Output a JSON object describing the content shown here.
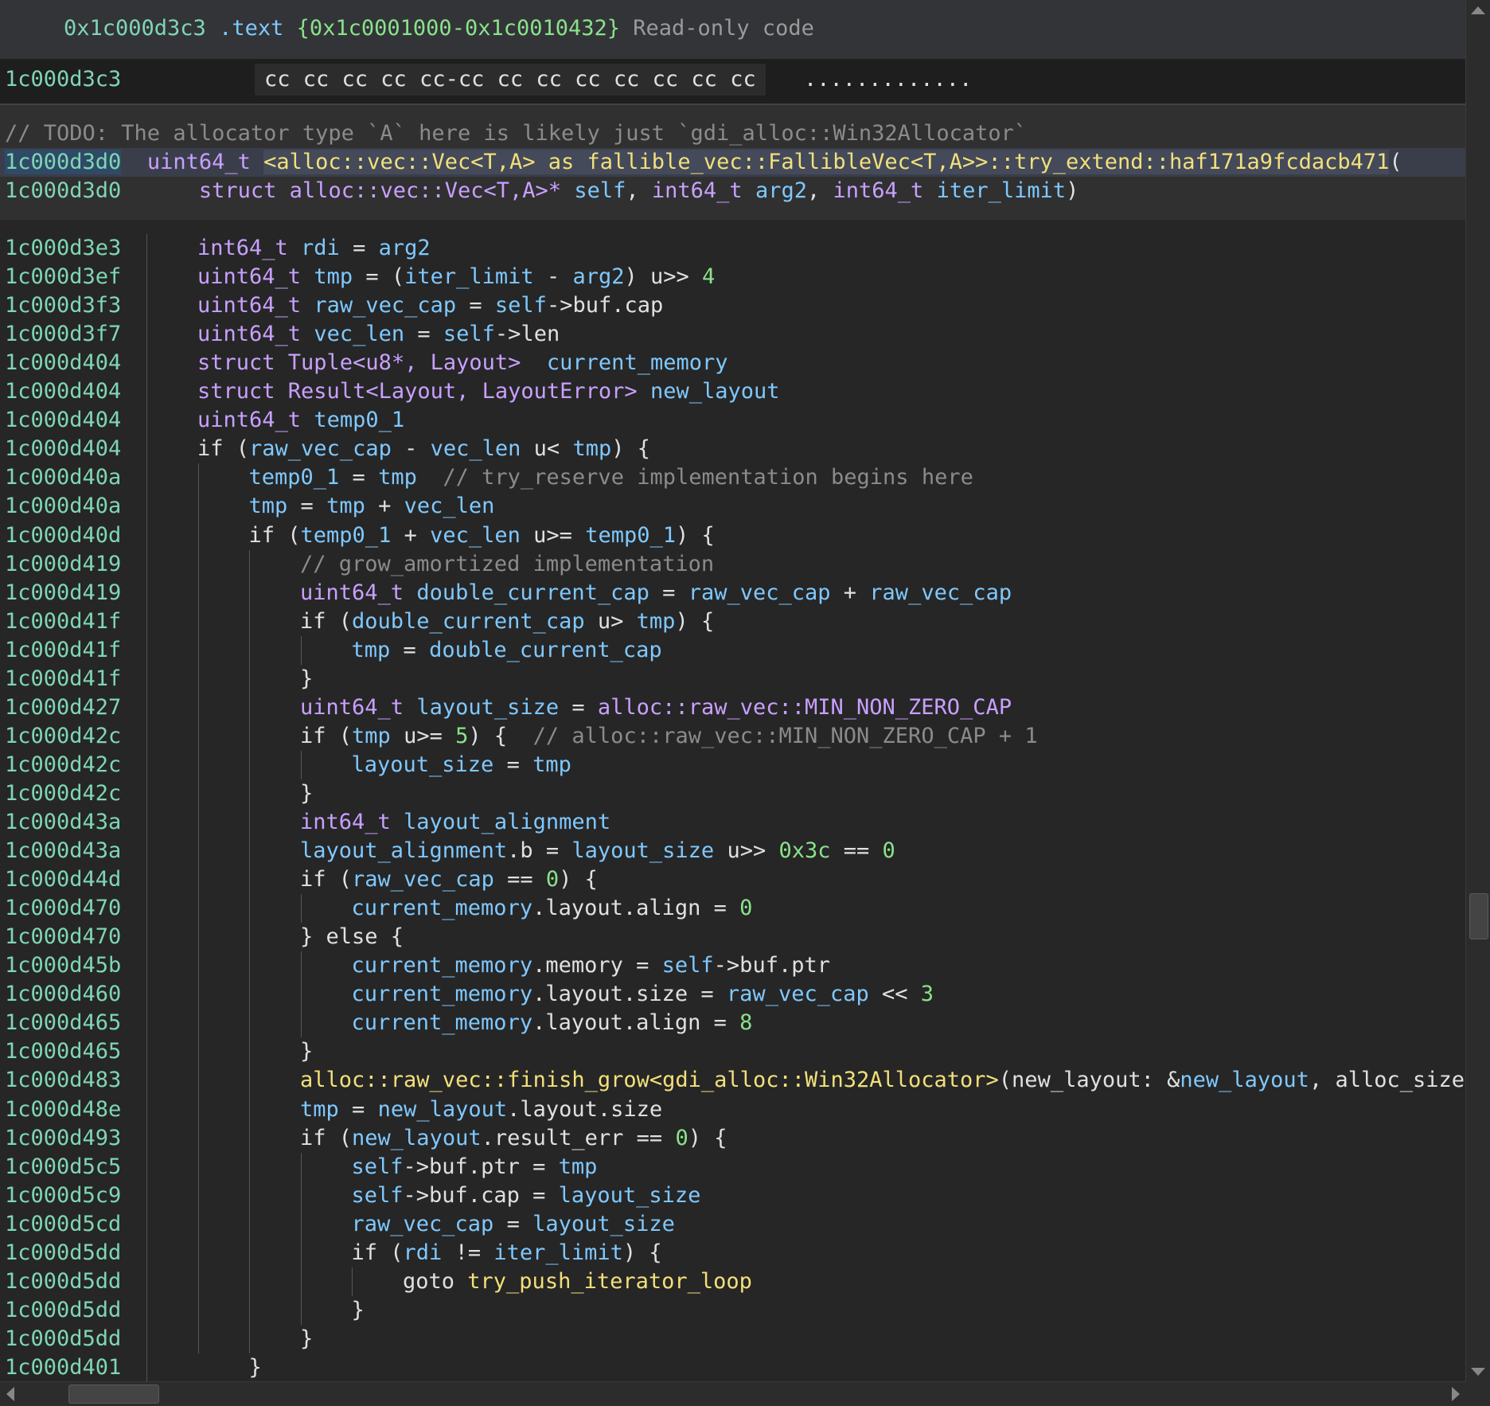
{
  "section": {
    "address": "0x1c000d3c3",
    "name": ".text",
    "range": "{0x1c0001000-0x1c0010432}",
    "kind": "Read-only code"
  },
  "hex": {
    "address": "1c000d3c3",
    "bytes": "cc cc cc cc cc-cc cc cc cc cc cc cc cc",
    "ascii": "............."
  },
  "function": {
    "todo_comment": "// TODO: The allocator type `A` here is likely just `gdi_alloc::Win32Allocator`",
    "address": "1c000d3d0",
    "return_type": "uint64_t",
    "name": "<alloc::vec::Vec<T,A> as fallible_vec::FallibleVec<T,A>>::try_extend::haf171a9fcdacb471",
    "open_paren": "(",
    "param_prefix": "struct",
    "param1_type": "alloc::vec::Vec<T,A>*",
    "param1_name": "self",
    "param2_type": "int64_t",
    "param2_name": "arg2",
    "param3_type": "int64_t",
    "param3_name": "iter_limit",
    "close_paren": ")",
    "comma": ","
  },
  "lines": [
    {
      "addr": "1c000d3e3",
      "indent": 1,
      "tokens": [
        [
          "type",
          "int64_t "
        ],
        [
          "var",
          "rdi"
        ],
        [
          "plain",
          " = "
        ],
        [
          "var",
          "arg2"
        ]
      ]
    },
    {
      "addr": "1c000d3ef",
      "indent": 1,
      "tokens": [
        [
          "type",
          "uint64_t "
        ],
        [
          "var",
          "tmp"
        ],
        [
          "plain",
          " = ("
        ],
        [
          "var",
          "iter_limit"
        ],
        [
          "plain",
          " - "
        ],
        [
          "var",
          "arg2"
        ],
        [
          "plain",
          ") u>> "
        ],
        [
          "num",
          "4"
        ]
      ]
    },
    {
      "addr": "1c000d3f3",
      "indent": 1,
      "tokens": [
        [
          "type",
          "uint64_t "
        ],
        [
          "var",
          "raw_vec_cap"
        ],
        [
          "plain",
          " = "
        ],
        [
          "var",
          "self"
        ],
        [
          "plain",
          "->buf.cap"
        ]
      ]
    },
    {
      "addr": "1c000d3f7",
      "indent": 1,
      "tokens": [
        [
          "type",
          "uint64_t "
        ],
        [
          "var",
          "vec_len"
        ],
        [
          "plain",
          " = "
        ],
        [
          "var",
          "self"
        ],
        [
          "plain",
          "->len"
        ]
      ]
    },
    {
      "addr": "1c000d404",
      "indent": 1,
      "tokens": [
        [
          "type",
          "struct Tuple<u8*, Layout>  "
        ],
        [
          "var",
          "current_memory"
        ]
      ]
    },
    {
      "addr": "1c000d404",
      "indent": 1,
      "tokens": [
        [
          "type",
          "struct Result<Layout, LayoutError> "
        ],
        [
          "var",
          "new_layout"
        ]
      ]
    },
    {
      "addr": "1c000d404",
      "indent": 1,
      "tokens": [
        [
          "type",
          "uint64_t "
        ],
        [
          "var",
          "temp0_1"
        ]
      ]
    },
    {
      "addr": "1c000d404",
      "indent": 1,
      "tokens": [
        [
          "plain",
          "if ("
        ],
        [
          "var",
          "raw_vec_cap"
        ],
        [
          "plain",
          " - "
        ],
        [
          "var",
          "vec_len"
        ],
        [
          "plain",
          " u< "
        ],
        [
          "var",
          "tmp"
        ],
        [
          "plain",
          ") {"
        ]
      ]
    },
    {
      "addr": "1c000d40a",
      "indent": 2,
      "tokens": [
        [
          "var",
          "temp0_1"
        ],
        [
          "plain",
          " = "
        ],
        [
          "var",
          "tmp"
        ],
        [
          "comment",
          "  // try_reserve implementation begins here"
        ]
      ]
    },
    {
      "addr": "1c000d40a",
      "indent": 2,
      "tokens": [
        [
          "var",
          "tmp"
        ],
        [
          "plain",
          " = "
        ],
        [
          "var",
          "tmp"
        ],
        [
          "plain",
          " + "
        ],
        [
          "var",
          "vec_len"
        ]
      ]
    },
    {
      "addr": "1c000d40d",
      "indent": 2,
      "tokens": [
        [
          "plain",
          "if ("
        ],
        [
          "var",
          "temp0_1"
        ],
        [
          "plain",
          " + "
        ],
        [
          "var",
          "vec_len"
        ],
        [
          "plain",
          " u>= "
        ],
        [
          "var",
          "temp0_1"
        ],
        [
          "plain",
          ") {"
        ]
      ]
    },
    {
      "addr": "1c000d419",
      "indent": 3,
      "tokens": [
        [
          "comment",
          "// grow_amortized implementation"
        ]
      ]
    },
    {
      "addr": "1c000d419",
      "indent": 3,
      "tokens": [
        [
          "type",
          "uint64_t "
        ],
        [
          "var",
          "double_current_cap"
        ],
        [
          "plain",
          " = "
        ],
        [
          "var",
          "raw_vec_cap"
        ],
        [
          "plain",
          " + "
        ],
        [
          "var",
          "raw_vec_cap"
        ]
      ]
    },
    {
      "addr": "1c000d41f",
      "indent": 3,
      "tokens": [
        [
          "plain",
          "if ("
        ],
        [
          "var",
          "double_current_cap"
        ],
        [
          "plain",
          " u> "
        ],
        [
          "var",
          "tmp"
        ],
        [
          "plain",
          ") {"
        ]
      ]
    },
    {
      "addr": "1c000d41f",
      "indent": 4,
      "tokens": [
        [
          "var",
          "tmp"
        ],
        [
          "plain",
          " = "
        ],
        [
          "var",
          "double_current_cap"
        ]
      ]
    },
    {
      "addr": "1c000d41f",
      "indent": 3,
      "tokens": [
        [
          "plain",
          "}"
        ]
      ]
    },
    {
      "addr": "1c000d427",
      "indent": 3,
      "tokens": [
        [
          "type",
          "uint64_t "
        ],
        [
          "var",
          "layout_size"
        ],
        [
          "plain",
          " = "
        ],
        [
          "type",
          "alloc::raw_vec::MIN_NON_ZERO_CAP"
        ]
      ]
    },
    {
      "addr": "1c000d42c",
      "indent": 3,
      "tokens": [
        [
          "plain",
          "if ("
        ],
        [
          "var",
          "tmp"
        ],
        [
          "plain",
          " u>= "
        ],
        [
          "num",
          "5"
        ],
        [
          "plain",
          ") {"
        ],
        [
          "comment",
          "  // alloc::raw_vec::MIN_NON_ZERO_CAP + 1"
        ]
      ]
    },
    {
      "addr": "1c000d42c",
      "indent": 4,
      "tokens": [
        [
          "var",
          "layout_size"
        ],
        [
          "plain",
          " = "
        ],
        [
          "var",
          "tmp"
        ]
      ]
    },
    {
      "addr": "1c000d42c",
      "indent": 3,
      "tokens": [
        [
          "plain",
          "}"
        ]
      ]
    },
    {
      "addr": "1c000d43a",
      "indent": 3,
      "tokens": [
        [
          "type",
          "int64_t "
        ],
        [
          "var",
          "layout_alignment"
        ]
      ]
    },
    {
      "addr": "1c000d43a",
      "indent": 3,
      "tokens": [
        [
          "var",
          "layout_alignment"
        ],
        [
          "plain",
          ".b = "
        ],
        [
          "var",
          "layout_size"
        ],
        [
          "plain",
          " u>> "
        ],
        [
          "num",
          "0x3c"
        ],
        [
          "plain",
          " == "
        ],
        [
          "num",
          "0"
        ]
      ]
    },
    {
      "addr": "1c000d44d",
      "indent": 3,
      "tokens": [
        [
          "plain",
          "if ("
        ],
        [
          "var",
          "raw_vec_cap"
        ],
        [
          "plain",
          " == "
        ],
        [
          "num",
          "0"
        ],
        [
          "plain",
          ") {"
        ]
      ]
    },
    {
      "addr": "1c000d470",
      "indent": 4,
      "tokens": [
        [
          "var",
          "current_memory"
        ],
        [
          "plain",
          ".layout.align = "
        ],
        [
          "num",
          "0"
        ]
      ]
    },
    {
      "addr": "1c000d470",
      "indent": 3,
      "tokens": [
        [
          "plain",
          "} else {"
        ]
      ]
    },
    {
      "addr": "1c000d45b",
      "indent": 4,
      "tokens": [
        [
          "var",
          "current_memory"
        ],
        [
          "plain",
          ".memory = "
        ],
        [
          "var",
          "self"
        ],
        [
          "plain",
          "->buf.ptr"
        ]
      ]
    },
    {
      "addr": "1c000d460",
      "indent": 4,
      "tokens": [
        [
          "var",
          "current_memory"
        ],
        [
          "plain",
          ".layout.size = "
        ],
        [
          "var",
          "raw_vec_cap"
        ],
        [
          "plain",
          " << "
        ],
        [
          "num",
          "3"
        ]
      ]
    },
    {
      "addr": "1c000d465",
      "indent": 4,
      "tokens": [
        [
          "var",
          "current_memory"
        ],
        [
          "plain",
          ".layout.align = "
        ],
        [
          "num",
          "8"
        ]
      ]
    },
    {
      "addr": "1c000d465",
      "indent": 3,
      "tokens": [
        [
          "plain",
          "}"
        ]
      ]
    },
    {
      "addr": "1c000d483",
      "indent": 3,
      "tokens": [
        [
          "func",
          "alloc::raw_vec::finish_grow<gdi_alloc::Win32Allocator>"
        ],
        [
          "plain",
          "(new_layout: &"
        ],
        [
          "var",
          "new_layout"
        ],
        [
          "plain",
          ", alloc_size:"
        ]
      ]
    },
    {
      "addr": "1c000d48e",
      "indent": 3,
      "tokens": [
        [
          "var",
          "tmp"
        ],
        [
          "plain",
          " = "
        ],
        [
          "var",
          "new_layout"
        ],
        [
          "plain",
          ".layout.size"
        ]
      ]
    },
    {
      "addr": "1c000d493",
      "indent": 3,
      "tokens": [
        [
          "plain",
          "if ("
        ],
        [
          "var",
          "new_layout"
        ],
        [
          "plain",
          ".result_err == "
        ],
        [
          "num",
          "0"
        ],
        [
          "plain",
          ") {"
        ]
      ]
    },
    {
      "addr": "1c000d5c5",
      "indent": 4,
      "tokens": [
        [
          "var",
          "self"
        ],
        [
          "plain",
          "->buf.ptr = "
        ],
        [
          "var",
          "tmp"
        ]
      ]
    },
    {
      "addr": "1c000d5c9",
      "indent": 4,
      "tokens": [
        [
          "var",
          "self"
        ],
        [
          "plain",
          "->buf.cap = "
        ],
        [
          "var",
          "layout_size"
        ]
      ]
    },
    {
      "addr": "1c000d5cd",
      "indent": 4,
      "tokens": [
        [
          "var",
          "raw_vec_cap"
        ],
        [
          "plain",
          " = "
        ],
        [
          "var",
          "layout_size"
        ]
      ]
    },
    {
      "addr": "1c000d5dd",
      "indent": 4,
      "tokens": [
        [
          "plain",
          "if ("
        ],
        [
          "var",
          "rdi"
        ],
        [
          "plain",
          " != "
        ],
        [
          "var",
          "iter_limit"
        ],
        [
          "plain",
          ") {"
        ]
      ]
    },
    {
      "addr": "1c000d5dd",
      "indent": 5,
      "tokens": [
        [
          "plain",
          "goto "
        ],
        [
          "func",
          "try_push_iterator_loop"
        ]
      ]
    },
    {
      "addr": "1c000d5dd",
      "indent": 4,
      "tokens": [
        [
          "plain",
          "}"
        ]
      ]
    },
    {
      "addr": "1c000d5dd",
      "indent": 3,
      "tokens": [
        [
          "plain",
          "}"
        ]
      ]
    },
    {
      "addr": "1c000d401",
      "indent": 2,
      "tokens": [
        [
          "plain",
          "}"
        ]
      ]
    }
  ],
  "guides": [
    {
      "indent": 1,
      "from": 0,
      "to": 39
    },
    {
      "indent": 2,
      "from": 8,
      "to": 38
    },
    {
      "indent": 3,
      "from": 11,
      "to": 38
    },
    {
      "indent": 4,
      "from": 14,
      "to": 14
    },
    {
      "indent": 4,
      "from": 18,
      "to": 18
    },
    {
      "indent": 4,
      "from": 23,
      "to": 23
    },
    {
      "indent": 4,
      "from": 25,
      "to": 27
    },
    {
      "indent": 4,
      "from": 32,
      "to": 37
    },
    {
      "indent": 5,
      "from": 36,
      "to": 36
    }
  ],
  "colors": {
    "background": "#262626",
    "address": "#7fd6b4",
    "type": "#c8a0ff",
    "variable": "#7fc8ff",
    "number": "#8ae28a",
    "function": "#f2e07a",
    "comment": "#8b8b8b"
  }
}
